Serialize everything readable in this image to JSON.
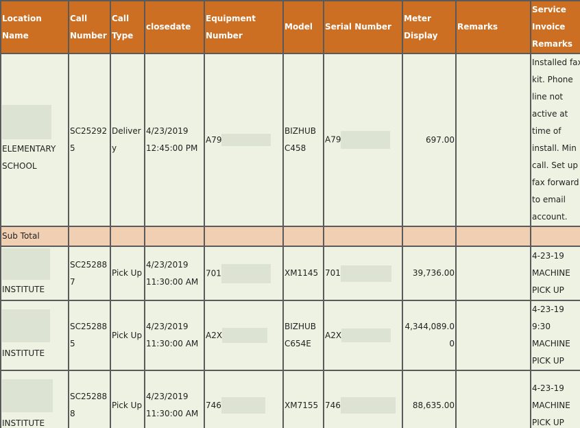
{
  "headers": {
    "location_name": "Location Name",
    "call_number": "Call Number",
    "call_type": "Call Type",
    "closedate": "closedate",
    "equipment_number": "Equipment Number",
    "model": "Model",
    "serial_number": "Serial Number",
    "meter_display": "Meter Display",
    "remarks": "Remarks",
    "service_invoice_remarks": "Service Invoice Remarks"
  },
  "rows": [
    {
      "location_line1": "ELEMENTARY",
      "location_line2": "SCHOOL",
      "call_number": "SC252925",
      "call_type": "Delivery",
      "date": "4/23/2019",
      "time": "12:45:00 PM",
      "equipment_prefix": "A79",
      "model_line1": "BIZHUB",
      "model_line2": "C458",
      "serial_prefix": "A79",
      "meter": "697.00",
      "remarks": "",
      "service_remarks": "Installed fax kit. Phone line not active at time of install. Min call. Set up fax forward to email account."
    },
    {
      "location_line1": "INSTITUTE",
      "call_number": "SC252887",
      "call_type": "Pick Up",
      "date": "4/23/2019",
      "time": "11:30:00 AM",
      "equipment_prefix": "701",
      "model_line1": "XM1145",
      "serial_prefix": "701",
      "meter": "39,736.00",
      "remarks": "",
      "service_remarks": "4-23-19 MACHINE PICK UP"
    },
    {
      "location_line1": "INSTITUTE",
      "call_number": "SC252885",
      "call_type": "Pick Up",
      "date": "4/23/2019",
      "time": "11:30:00 AM",
      "equipment_prefix": "A2X",
      "model_line1": "BIZHUB",
      "model_line2": "C654E",
      "serial_prefix": "A2X",
      "meter": "4,344,089.00",
      "remarks": "",
      "service_remarks": "4-23-19 9:30 MACHINE PICK UP"
    },
    {
      "location_line1": "INSTITUTE",
      "call_number": "SC252888",
      "call_type": "Pick Up",
      "date": "4/23/2019",
      "time": "11:30:00 AM",
      "equipment_prefix": "746",
      "model_line1": "XM7155",
      "serial_prefix": "746",
      "meter": "88,635.00",
      "remarks": "",
      "service_remarks": "4-23-19 MACHINE PICK UP"
    }
  ],
  "subtotal_label": "Sub Total"
}
